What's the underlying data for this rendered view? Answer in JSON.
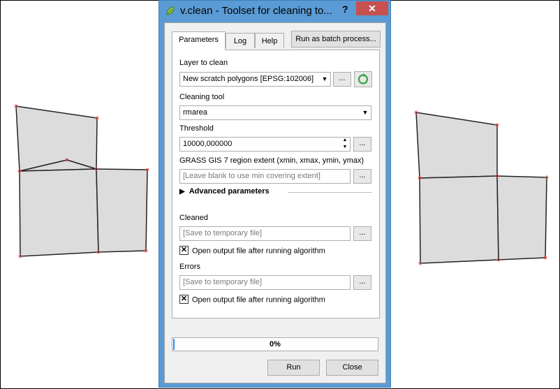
{
  "window": {
    "title": "v.clean - Toolset for cleaning to...",
    "help_glyph": "?",
    "close_glyph": "✕"
  },
  "tabs": [
    {
      "label": "Parameters"
    },
    {
      "label": "Log"
    },
    {
      "label": "Help"
    }
  ],
  "batch_button_label": "Run as batch process...",
  "layer_to_clean": {
    "label": "Layer to clean",
    "value": "New scratch polygons [EPSG:102006]"
  },
  "cleaning_tool": {
    "label": "Cleaning tool",
    "value": "rmarea"
  },
  "threshold": {
    "label": "Threshold",
    "value": "10000,000000"
  },
  "region_extent": {
    "label": "GRASS GIS 7 region extent (xmin, xmax, ymin, ymax)",
    "placeholder": "[Leave blank to use min covering extent]"
  },
  "advanced_label": "Advanced parameters",
  "cleaned": {
    "label": "Cleaned",
    "placeholder": "[Save to temporary file]",
    "open_label": "Open output file after running algorithm",
    "open_checked": true
  },
  "errors": {
    "label": "Errors",
    "placeholder": "[Save to temporary file]",
    "open_label": "Open output file after running algorithm",
    "open_checked": true
  },
  "dots_label": "...",
  "progress": {
    "value": 0,
    "text": "0%"
  },
  "buttons": {
    "run": "Run",
    "close": "Close"
  },
  "colors": {
    "polygon_fill": "#dcdcdc",
    "polygon_stroke": "#222222",
    "vertex": "#ff5a5a",
    "titlebar": "#5b9bd5",
    "close_button": "#c75050",
    "progress_fill": "#1e90ff",
    "refresh_icon": "#3aa540"
  }
}
